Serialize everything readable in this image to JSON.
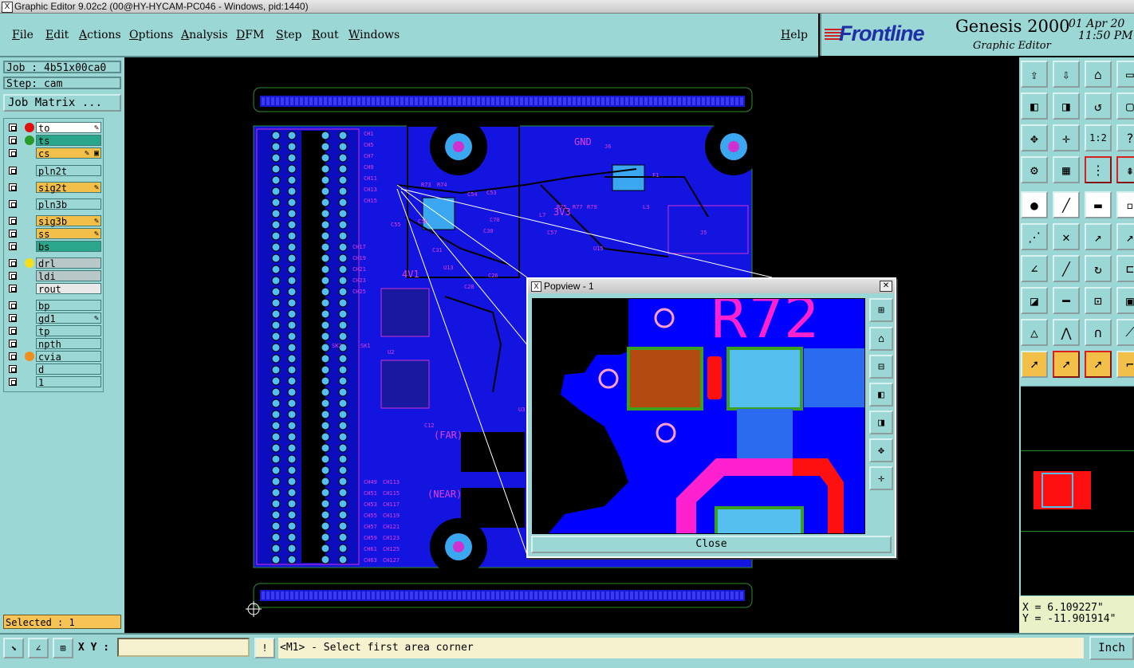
{
  "window": {
    "title": "Graphic Editor 9.02c2 (00@HY-HYCAM-PC046 - Windows, pid:1440)"
  },
  "menu": {
    "items": [
      "File",
      "Edit",
      "Actions",
      "Options",
      "Analysis",
      "DFM",
      "Step",
      "Rout",
      "Windows"
    ],
    "help": "Help"
  },
  "brand": {
    "logo": "Frontline",
    "product": "Genesis 2000",
    "subtitle": "Graphic Editor",
    "date": "01 Apr 20",
    "time": "11:50 PM"
  },
  "job": {
    "job_label": "Job : 4b51x00ca0",
    "step_label": "Step: cam",
    "matrix_button": "Job Matrix ..."
  },
  "layers": [
    {
      "name": "to",
      "dot": "#e01010",
      "bg": "#ffffff",
      "flag": "✎"
    },
    {
      "name": "ts",
      "dot": "#2a9a2a",
      "bg": "#2aa78a",
      "flag": ""
    },
    {
      "name": "cs",
      "dot": "",
      "bg": "#f2c048",
      "flag": "✎ ▣"
    },
    {
      "name": "pln2t",
      "dot": "",
      "bg": "#9bd7d4",
      "flag": ""
    },
    {
      "name": "sig2t",
      "dot": "",
      "bg": "#f2c048",
      "flag": "✎"
    },
    {
      "name": "pln3b",
      "dot": "",
      "bg": "#9bd7d4",
      "flag": ""
    },
    {
      "name": "sig3b",
      "dot": "",
      "bg": "#f2c048",
      "flag": "✎"
    },
    {
      "name": "ss",
      "dot": "",
      "bg": "#f2c048",
      "flag": "✎"
    },
    {
      "name": "bs",
      "dot": "",
      "bg": "#2aa78a",
      "flag": ""
    },
    {
      "name": "drl",
      "dot": "#f2e020",
      "bg": "#b8c8c8",
      "flag": ""
    },
    {
      "name": "ldi",
      "dot": "",
      "bg": "#b8c8c8",
      "flag": ""
    },
    {
      "name": "rout",
      "dot": "",
      "bg": "#e8e8e8",
      "flag": ""
    },
    {
      "name": "bp",
      "dot": "",
      "bg": "#9bd7d4",
      "flag": ""
    },
    {
      "name": "gd1",
      "dot": "",
      "bg": "#9bd7d4",
      "flag": "✎"
    },
    {
      "name": "tp",
      "dot": "",
      "bg": "#9bd7d4",
      "flag": ""
    },
    {
      "name": "npth",
      "dot": "",
      "bg": "#9bd7d4",
      "flag": ""
    },
    {
      "name": "cvia",
      "dot": "#f0901c",
      "bg": "#9bd7d4",
      "flag": ""
    },
    {
      "name": "d",
      "dot": "",
      "bg": "#9bd7d4",
      "flag": ""
    },
    {
      "name": "1",
      "dot": "",
      "bg": "#9bd7d4",
      "flag": ""
    }
  ],
  "status": {
    "selected": "Selected : 1",
    "xy_label": "X Y :",
    "xy_value": "",
    "message": "<M1> - Select first area corner",
    "unit": "Inch"
  },
  "coords": {
    "x": "X = 6.109227\"",
    "y": "Y = -11.901914\""
  },
  "popup": {
    "title": "Popview - 1",
    "close_label": "Close",
    "close_x": "✕"
  },
  "board_labels": [
    "CH1",
    "CH5",
    "CH7",
    "CH9",
    "CH11",
    "CH13",
    "CH15",
    "CH17",
    "CH19",
    "CH21",
    "CH23",
    "CH25",
    "GND",
    "J6",
    "F1",
    "L3",
    "L7",
    "3V3",
    "C53",
    "C54",
    "C70",
    "C30",
    "C55",
    "C56",
    "C57",
    "U15",
    "U13",
    "R73",
    "R74",
    "R75",
    "R77",
    "R79",
    "C31",
    "C26",
    "C28",
    "4V1",
    "SK1",
    "SK2",
    "U2",
    "U3",
    "(FAR)",
    "(NEAR)",
    "CH49",
    "CH51",
    "CH53",
    "CH55",
    "CH57",
    "CH59",
    "CH61",
    "CH63",
    "CH113",
    "CH115",
    "CH117",
    "CH119",
    "CH121",
    "CH123",
    "CH125",
    "CH127",
    "C12",
    "J5"
  ],
  "popview_labels": [
    "R72"
  ]
}
